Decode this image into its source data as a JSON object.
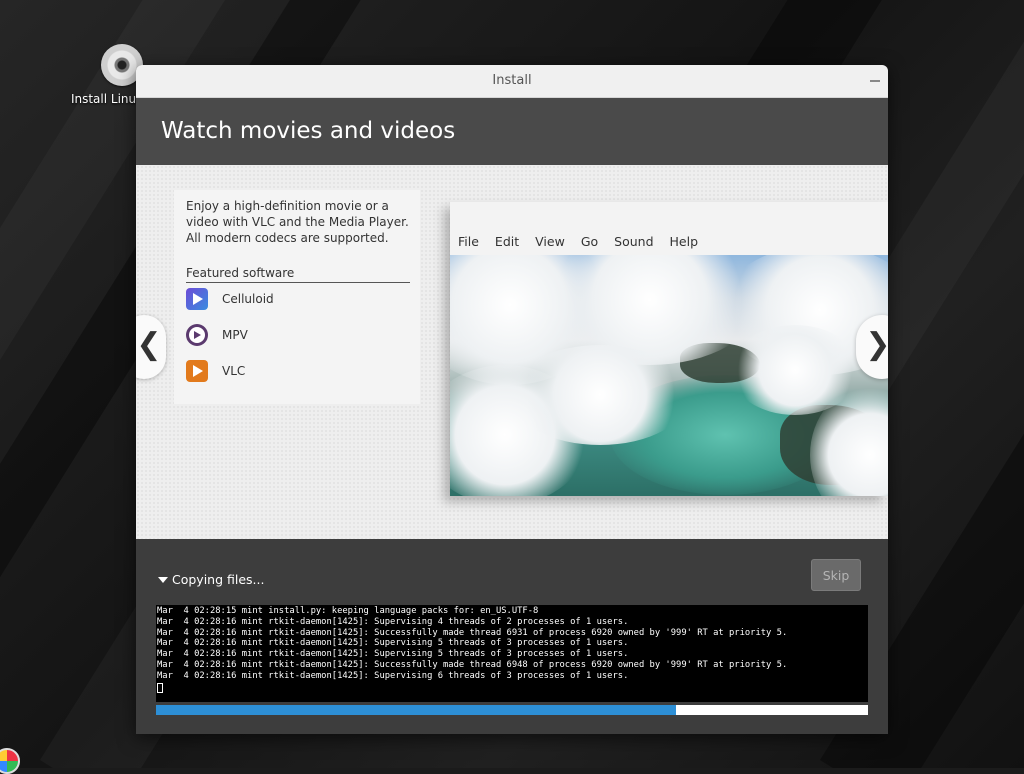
{
  "desktop": {
    "icon_label": "Install Linux Mint"
  },
  "window": {
    "title": "Install",
    "header": "Watch movies and videos"
  },
  "slide": {
    "description": "Enjoy a high-definition movie or a video with VLC and the Media Player. All modern codecs are supported.",
    "featured_title": "Featured software",
    "apps": [
      {
        "name": "Celluloid",
        "icon": "celluloid-icon"
      },
      {
        "name": "MPV",
        "icon": "mpv-icon"
      },
      {
        "name": "VLC",
        "icon": "vlc-icon"
      }
    ],
    "player_menu": [
      "File",
      "Edit",
      "View",
      "Go",
      "Sound",
      "Help"
    ],
    "prev_glyph": "❮",
    "next_glyph": "❯"
  },
  "footer": {
    "status": "Copying files...",
    "skip_label": "Skip",
    "log_lines": [
      "Mar  4 02:28:15 mint install.py: keeping language packs for: en_US.UTF-8",
      "Mar  4 02:28:16 mint rtkit-daemon[1425]: Supervising 4 threads of 2 processes of 1 users.",
      "Mar  4 02:28:16 mint rtkit-daemon[1425]: Successfully made thread 6931 of process 6920 owned by '999' RT at priority 5.",
      "Mar  4 02:28:16 mint rtkit-daemon[1425]: Supervising 5 threads of 3 processes of 1 users.",
      "Mar  4 02:28:16 mint rtkit-daemon[1425]: Supervising 5 threads of 3 processes of 1 users.",
      "Mar  4 02:28:16 mint rtkit-daemon[1425]: Successfully made thread 6948 of process 6920 owned by '999' RT at priority 5.",
      "Mar  4 02:28:16 mint rtkit-daemon[1425]: Supervising 6 threads of 3 processes of 1 users."
    ],
    "progress": 0.73
  },
  "colors": {
    "progress_fill": "#2d8fd6",
    "header_bg": "#4a4a4a",
    "window_bg": "#3d3d3d"
  }
}
